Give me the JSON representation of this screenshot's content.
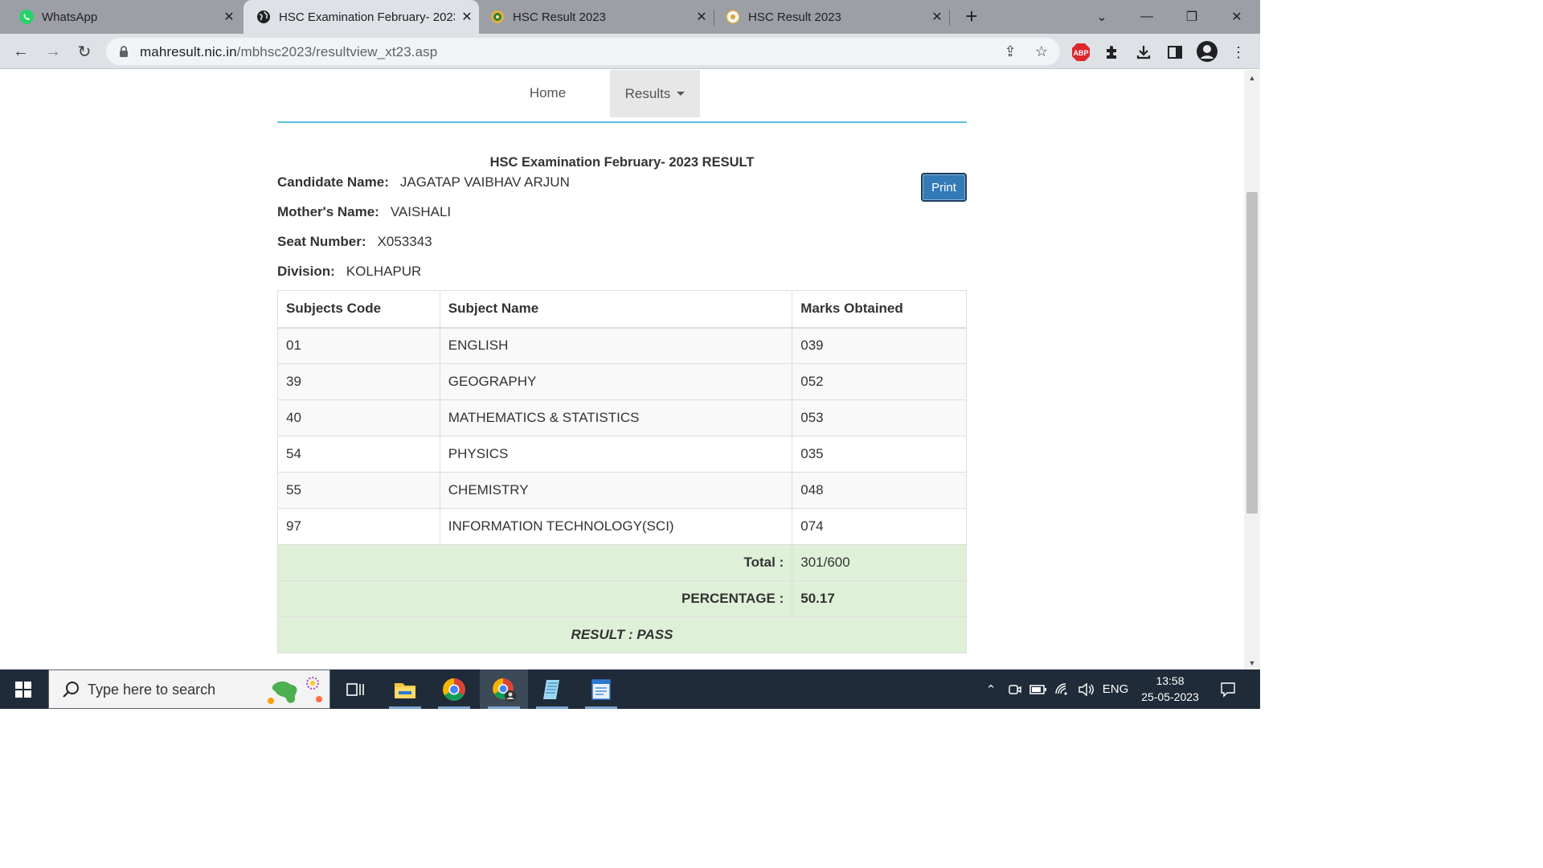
{
  "browser": {
    "tabs": [
      {
        "title": "WhatsApp",
        "active": false
      },
      {
        "title": "HSC Examination February- 2023 RESULT",
        "active": true
      },
      {
        "title": "HSC Result 2023",
        "active": false
      },
      {
        "title": "HSC Result 2023",
        "active": false
      }
    ],
    "url_host": "mahresult.nic.in",
    "url_path": "/mbhsc2023/resultview_xt23.asp",
    "extension_abp_label": "ABP"
  },
  "page": {
    "nav": {
      "home": "Home",
      "results": "Results"
    },
    "exam_title": "HSC Examination February- 2023 RESULT",
    "print_label": "Print",
    "candidate": {
      "name_label": "Candidate Name:",
      "name_value": "JAGATAP VAIBHAV ARJUN",
      "mother_label": "Mother's Name:",
      "mother_value": "VAISHALI",
      "seat_label": "Seat Number:",
      "seat_value": "X053343",
      "division_label": "Division:",
      "division_value": "KOLHAPUR"
    },
    "table": {
      "headers": [
        "Subjects Code",
        "Subject Name",
        "Marks Obtained"
      ],
      "rows": [
        {
          "code": "01",
          "name": "ENGLISH",
          "marks": "039"
        },
        {
          "code": "39",
          "name": "GEOGRAPHY",
          "marks": "052"
        },
        {
          "code": "40",
          "name": "MATHEMATICS & STATISTICS",
          "marks": "053"
        },
        {
          "code": "54",
          "name": "PHYSICS",
          "marks": "035"
        },
        {
          "code": "55",
          "name": "CHEMISTRY",
          "marks": "048"
        },
        {
          "code": "97",
          "name": "INFORMATION TECHNOLOGY(SCI)",
          "marks": "074"
        }
      ],
      "total_label": "Total :",
      "total_value": "301/600",
      "percentage_label": "PERCENTAGE :",
      "percentage_value": "50.17",
      "result": "RESULT : PASS"
    },
    "colors": {
      "accent_line": "#5bc0de",
      "print_button": "#337ab7",
      "success_row": "#dff0d8"
    }
  },
  "taskbar": {
    "search_placeholder": "Type here to search",
    "language": "ENG",
    "time": "13:58",
    "date": "25-05-2023"
  }
}
